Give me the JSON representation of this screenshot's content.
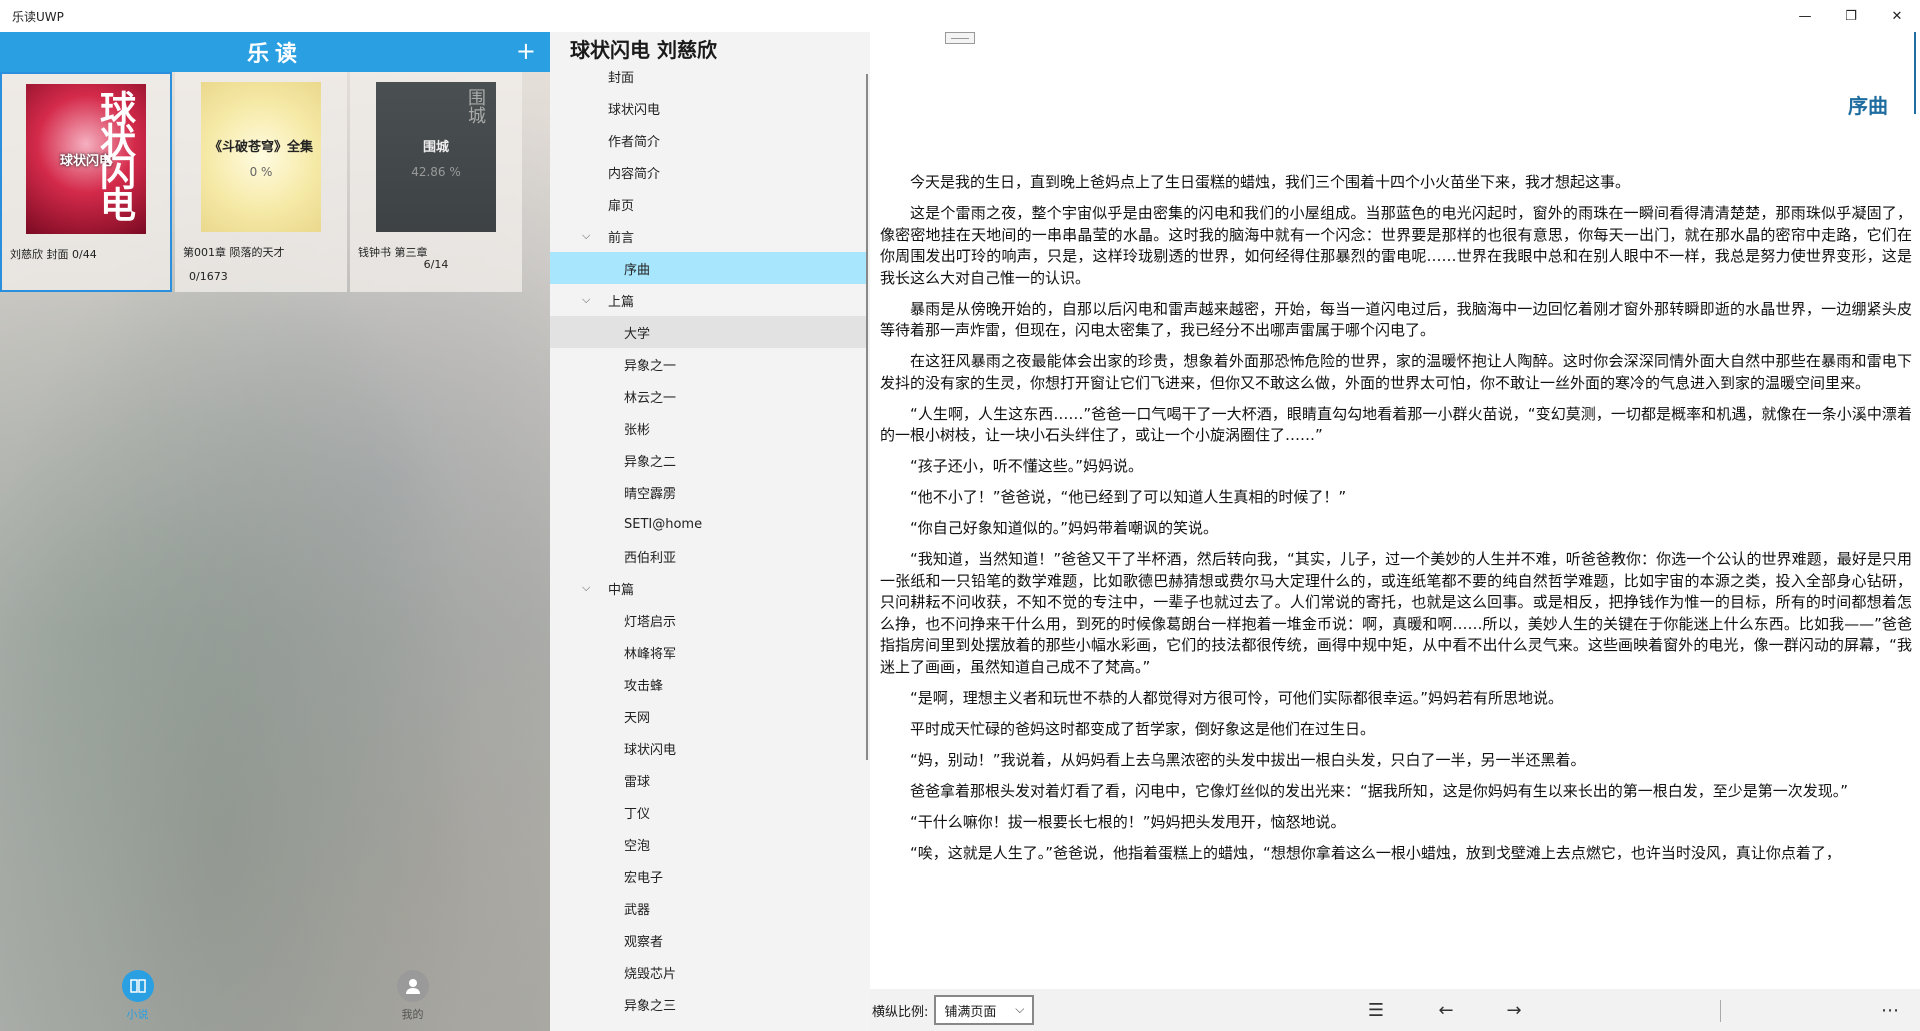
{
  "window": {
    "title": "乐读UWP",
    "minimize": "—",
    "maximize": "❐",
    "close": "✕"
  },
  "library": {
    "header_title": "乐读",
    "add_label": "+",
    "books": [
      {
        "cover_title": "球状闪电",
        "cover_big": "球状闪电",
        "cover_pct": "",
        "meta1": "刘慈欣 封面 0/44",
        "meta2": ""
      },
      {
        "cover_title": "《斗破苍穹》全集",
        "cover_big": "",
        "cover_pct": "0 %",
        "meta1": "第001章 陨落的天才",
        "meta2": "0/1673"
      },
      {
        "cover_title": "围城",
        "cover_big": "围城",
        "cover_pct": "42.86 %",
        "meta1": "钱钟书 第三章",
        "meta2": "6/14"
      }
    ],
    "nav": [
      {
        "label": "小说",
        "icon": "book-icon"
      },
      {
        "label": "我的",
        "icon": "user-icon"
      }
    ]
  },
  "toc": {
    "title": "球状闪电 刘慈欣",
    "items": [
      {
        "label": "封面",
        "level": 0
      },
      {
        "label": "球状闪电",
        "level": 0
      },
      {
        "label": "作者简介",
        "level": 0
      },
      {
        "label": "内容简介",
        "level": 0
      },
      {
        "label": "扉页",
        "level": 0
      },
      {
        "label": "前言",
        "level": 0,
        "expanded": true
      },
      {
        "label": "序曲",
        "level": 1,
        "selected": true
      },
      {
        "label": "上篇",
        "level": 0,
        "expanded": true
      },
      {
        "label": "大学",
        "level": 1,
        "hover": true
      },
      {
        "label": "异象之一",
        "level": 1
      },
      {
        "label": "林云之一",
        "level": 1
      },
      {
        "label": "张彬",
        "level": 1
      },
      {
        "label": "异象之二",
        "level": 1
      },
      {
        "label": "晴空霹雳",
        "level": 1
      },
      {
        "label": "SETI@home",
        "level": 1
      },
      {
        "label": "西伯利亚",
        "level": 1
      },
      {
        "label": "中篇",
        "level": 0,
        "expanded": true
      },
      {
        "label": "灯塔启示",
        "level": 1
      },
      {
        "label": "林峰将军",
        "level": 1
      },
      {
        "label": "攻击蜂",
        "level": 1
      },
      {
        "label": "天网",
        "level": 1
      },
      {
        "label": "球状闪电",
        "level": 1
      },
      {
        "label": "雷球",
        "level": 1
      },
      {
        "label": "丁仪",
        "level": 1
      },
      {
        "label": "空泡",
        "level": 1
      },
      {
        "label": "宏电子",
        "level": 1
      },
      {
        "label": "武器",
        "level": 1
      },
      {
        "label": "观察者",
        "level": 1
      },
      {
        "label": "烧毁芯片",
        "level": 1
      },
      {
        "label": "异象之三",
        "level": 1
      }
    ]
  },
  "reader": {
    "chapter_title": "序曲",
    "paragraphs": [
      "今天是我的生日，直到晚上爸妈点上了生日蛋糕的蜡烛，我们三个围着十四个小火苗坐下来，我才想起这事。",
      "这是个雷雨之夜，整个宇宙似乎是由密集的闪电和我们的小屋组成。当那蓝色的电光闪起时，窗外的雨珠在一瞬间看得清清楚楚，那雨珠似乎凝固了，像密密地挂在天地间的一串串晶莹的水晶。这时我的脑海中就有一个闪念：世界要是那样的也很有意思，你每天一出门，就在那水晶的密帘中走路，它们在你周围发出叮玲的响声，只是，这样玲珑剔透的世界，如何经得住那暴烈的雷电呢……世界在我眼中总和在别人眼中不一样，我总是努力使世界变形，这是我长这么大对自己惟一的认识。",
      "暴雨是从傍晚开始的，自那以后闪电和雷声越来越密，开始，每当一道闪电过后，我脑海中一边回忆着刚才窗外那转瞬即逝的水晶世界，一边绷紧头皮等待着那一声炸雷，但现在，闪电太密集了，我已经分不出哪声雷属于哪个闪电了。",
      "在这狂风暴雨之夜最能体会出家的珍贵，想象着外面那恐怖危险的世界，家的温暖怀抱让人陶醉。这时你会深深同情外面大自然中那些在暴雨和雷电下发抖的没有家的生灵，你想打开窗让它们飞进来，但你又不敢这么做，外面的世界太可怕，你不敢让一丝外面的寒冷的气息进入到家的温暖空间里来。",
      "“人生啊，人生这东西……”爸爸一口气喝干了一大杯酒，眼睛直勾勾地看着那一小群火苗说，“变幻莫测，一切都是概率和机遇，就像在一条小溪中漂着的一根小树枝，让一块小石头绊住了，或让一个小旋涡圈住了……”",
      "“孩子还小，听不懂这些。”妈妈说。",
      "“他不小了！”爸爸说，“他已经到了可以知道人生真相的时候了！”",
      "“你自己好象知道似的。”妈妈带着嘲讽的笑说。",
      "“我知道，当然知道！”爸爸又干了半杯酒，然后转向我，“其实，儿子，过一个美妙的人生并不难，听爸爸教你：你选一个公认的世界难题，最好是只用一张纸和一只铅笔的数学难题，比如歌德巴赫猜想或费尔马大定理什么的，或连纸笔都不要的纯自然哲学难题，比如宇宙的本源之类，投入全部身心钻研，只问耕耘不问收获，不知不觉的专注中，一辈子也就过去了。人们常说的寄托，也就是这么回事。或是相反，把挣钱作为惟一的目标，所有的时间都想着怎么挣，也不问挣来干什么用，到死的时候像葛朗台一样抱着一堆金币说：啊，真暖和啊……所以，美妙人生的关键在于你能迷上什么东西。比如我——”爸爸指指房间里到处摆放着的那些小幅水彩画，它们的技法都很传统，画得中规中矩，从中看不出什么灵气来。这些画映着窗外的电光，像一群闪动的屏幕，“我迷上了画画，虽然知道自己成不了梵高。”",
      "“是啊，理想主义者和玩世不恭的人都觉得对方很可怜，可他们实际都很幸运。”妈妈若有所思地说。",
      "平时成天忙碌的爸妈这时都变成了哲学家，倒好象这是他们在过生日。",
      "“妈，别动！”我说着，从妈妈看上去乌黑浓密的头发中拔出一根白头发，只白了一半，另一半还黑着。",
      "爸爸拿着那根头发对着灯看了看，闪电中，它像灯丝似的发出光来：“据我所知，这是你妈妈有生以来长出的第一根白发，至少是第一次发现。”",
      "“干什么嘛你！拔一根要长七根的！”妈妈把头发甩开，恼怒地说。",
      "“唉，这就是人生了。”爸爸说，他指着蛋糕上的蜡烛，“想想你拿着这么一根小蜡烛，放到戈壁滩上去点燃它，也许当时没风，真让你点着了，"
    ]
  },
  "bottombar": {
    "label": "横纵比例:",
    "select_value": "铺满页面",
    "caret": "⌵",
    "toc_icon": "☰",
    "prev_icon": "←",
    "next_icon": "→",
    "more_icon": "⋯"
  }
}
